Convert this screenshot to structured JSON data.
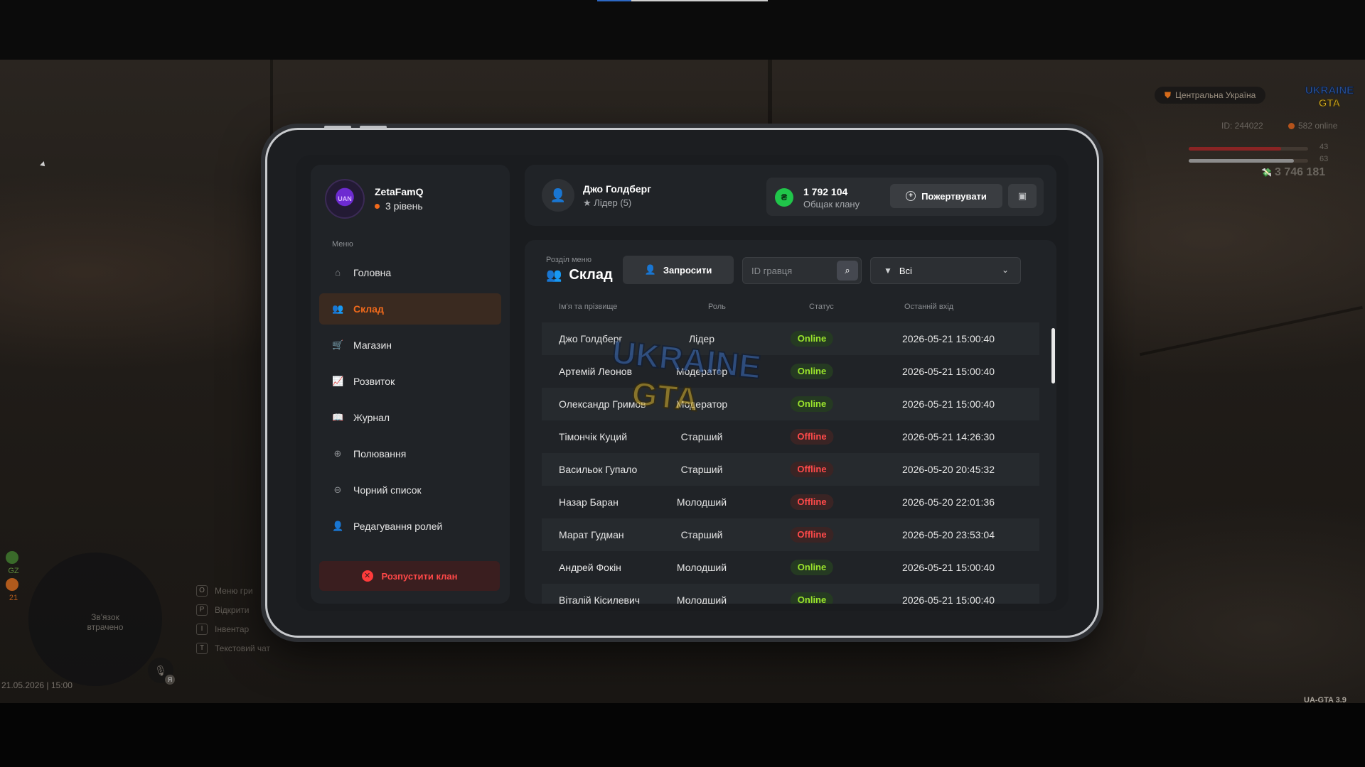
{
  "hud": {
    "region": "Центральна Україна",
    "logo": "UKRAINE GTA",
    "player_id": "ID: 244022",
    "online": "582 online",
    "health": 43,
    "armor": 63,
    "money": "3 746 181",
    "minimap_text": "Зв'язок втрачено",
    "gz_label": "GZ",
    "gz_count": "21",
    "keys": [
      {
        "key": "O",
        "label": "Меню гри"
      },
      {
        "key": "P",
        "label": "Відкрити"
      },
      {
        "key": "I",
        "label": "Інвентар"
      },
      {
        "key": "T",
        "label": "Текстовий чат"
      }
    ],
    "mic_badge": "Я",
    "datetime": "21.05.2026 | 15:00",
    "version": "UA-GTA 3.9"
  },
  "profile": {
    "name": "ZetaFamQ",
    "level": "3 рівень",
    "avatar_text": "UAN"
  },
  "menu": {
    "caption": "Меню",
    "items": [
      {
        "label": "Головна",
        "icon": "home-icon",
        "glyph": "⌂"
      },
      {
        "label": "Склад",
        "icon": "people-icon",
        "glyph": "👥"
      },
      {
        "label": "Магазин",
        "icon": "basket-icon",
        "glyph": "🛒"
      },
      {
        "label": "Розвиток",
        "icon": "chart-icon",
        "glyph": "📈"
      },
      {
        "label": "Журнал",
        "icon": "book-icon",
        "glyph": "📖"
      },
      {
        "label": "Полювання",
        "icon": "crosshair-icon",
        "glyph": "⊕"
      },
      {
        "label": "Чорний список",
        "icon": "blocked-icon",
        "glyph": "⊖"
      },
      {
        "label": "Редагування ролей",
        "icon": "user-edit-icon",
        "glyph": "👤"
      }
    ],
    "active_index": 1,
    "dissolve_label": "Розпустити клан"
  },
  "header": {
    "user_name": "Джо Голдберг",
    "user_role": "Лідер (5)",
    "bank_amount": "1 792 104",
    "bank_caption": "Общак клану",
    "donate_label": "Пожертвувати",
    "currency_glyph": "₴"
  },
  "section": {
    "caption": "Розділ меню",
    "title": "Склад",
    "invite_label": "Запросити",
    "search_placeholder": "ID гравця",
    "filter_value": "Всі"
  },
  "table": {
    "headers": [
      "Ім'я та прізвище",
      "Роль",
      "Статус",
      "Останній вхід"
    ],
    "rows": [
      {
        "name": "Джо Голдберг",
        "role": "Лідер",
        "status": "Online",
        "last": "2026-05-21 15:00:40"
      },
      {
        "name": "Артемій Леонов",
        "role": "Модератор",
        "status": "Online",
        "last": "2026-05-21 15:00:40"
      },
      {
        "name": "Олександр Гримов",
        "role": "Модератор",
        "status": "Online",
        "last": "2026-05-21 15:00:40"
      },
      {
        "name": "Тімончік Куций",
        "role": "Старший",
        "status": "Offline",
        "last": "2026-05-21 14:26:30"
      },
      {
        "name": "Васильок Гупало",
        "role": "Старший",
        "status": "Offline",
        "last": "2026-05-20 20:45:32"
      },
      {
        "name": "Назар Баран",
        "role": "Молодший",
        "status": "Offline",
        "last": "2026-05-20 22:01:36"
      },
      {
        "name": "Марат Гудман",
        "role": "Старший",
        "status": "Offline",
        "last": "2026-05-20 23:53:04"
      },
      {
        "name": "Андрей Фокін",
        "role": "Молодший",
        "status": "Online",
        "last": "2026-05-21 15:00:40"
      },
      {
        "name": "Віталій Кісилевич",
        "role": "Молодший",
        "status": "Online",
        "last": "2026-05-21 15:00:40"
      }
    ]
  },
  "colors": {
    "accent": "#f26a1b",
    "online": "#9be52c",
    "offline": "#ff4a4a",
    "danger": "#ff4848",
    "money": "#20c54a"
  }
}
